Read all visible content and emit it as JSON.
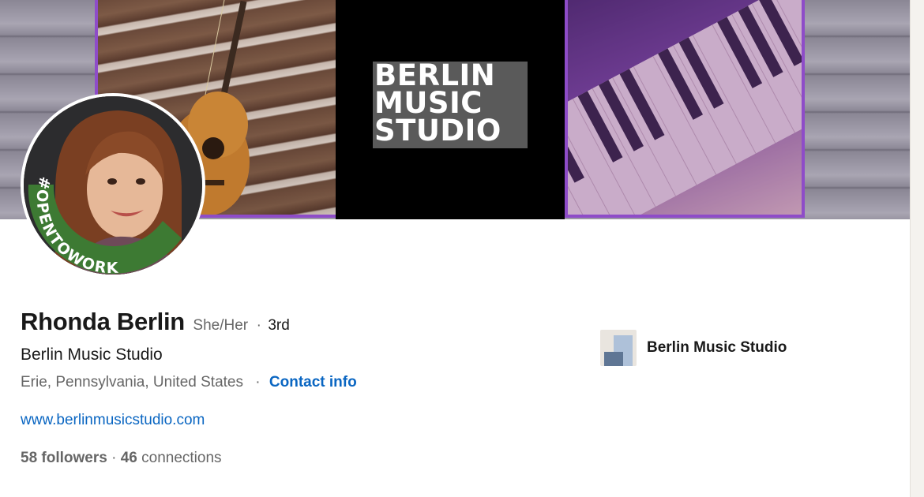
{
  "banner": {
    "logo_lines": [
      "BERLIN",
      "MUSIC",
      "STUDIO"
    ],
    "accent_color": "#8e4cc8"
  },
  "avatar": {
    "badge_text": "#OPENTOWORK",
    "badge_color": "#3d7a33"
  },
  "profile": {
    "name": "Rhonda Berlin",
    "pronouns": "She/Her",
    "separator": "·",
    "degree": "3rd",
    "headline": "Berlin Music Studio",
    "location": "Erie, Pennsylvania, United States",
    "contact_label": "Contact info",
    "website": "www.berlinmusicstudio.com",
    "followers_count": "58 followers",
    "connections_count": "46",
    "connections_label": "connections"
  },
  "company": {
    "name": "Berlin Music Studio"
  },
  "colors": {
    "link": "#0a66c2",
    "text_primary": "#191919",
    "text_secondary": "#666666"
  }
}
